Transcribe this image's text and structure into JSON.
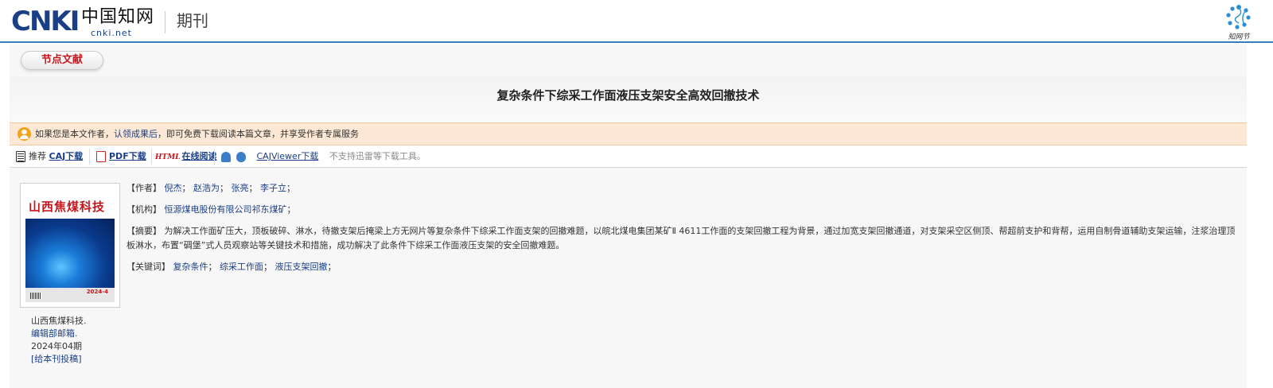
{
  "header": {
    "logo_text": "CNKI",
    "logo_cn": "中国知网",
    "logo_url": "cnki.net",
    "section": "期刊",
    "right_logo_text": "知网节"
  },
  "node": {
    "button_label": "节点文献"
  },
  "article": {
    "title": "复杂条件下综采工作面液压支架安全高效回撤技术"
  },
  "notice": {
    "text_before": "如果您是本文作者，",
    "link": "认领成果后",
    "text_after": "，即可免费下载阅读本篇文章，并享受作者专属服务"
  },
  "toolbar": {
    "recommend_label": "推荐",
    "caj_label": "CAJ下载",
    "pdf_label": "PDF下载",
    "html_icon_text": "HTML",
    "online_label": "在线阅读",
    "viewer_label": "CAJViewer下载",
    "tip": "不支持迅雷等下载工具。"
  },
  "cover": {
    "title": "山西焦煤科技",
    "issue": "2024-4"
  },
  "journal": {
    "name": "山西焦煤科技.",
    "editor_link": "编辑部邮箱.",
    "issue": "2024年04期",
    "submit_link": "[给本刊投稿]"
  },
  "fields": {
    "authors_label": "【作者】",
    "authors": [
      "倪杰",
      "赵浩为",
      "张亮",
      "李子立"
    ],
    "org_label": "【机构】",
    "org": "恒源煤电股份有限公司祁东煤矿",
    "abstract_label": "【摘要】",
    "abstract": "为解决工作面矿压大，顶板破碎、淋水，待撤支架后掩梁上方无网片等复杂条件下综采工作面支架的回撤难题，以皖北煤电集团某矿Ⅱ 4611工作面的支架回撤工程为背景，通过加宽支架回撤通道，对支架采空区侧顶、帮超前支护和背帮，运用自制骨道辅助支架运输，注浆治理顶板淋水，布置“碉堡”式人员观察站等关键技术和措施，成功解决了此条件下综采工作面液压支架的安全回撤难题。",
    "keywords_label": "【关键词】",
    "keywords": [
      "复杂条件",
      "综采工作面",
      "液压支架回撤"
    ]
  },
  "colors": {
    "link": "#1a3f86",
    "accent_red": "#c8161d",
    "notice_bg": "#fce8d5",
    "header_rule": "#3a7dbf"
  }
}
